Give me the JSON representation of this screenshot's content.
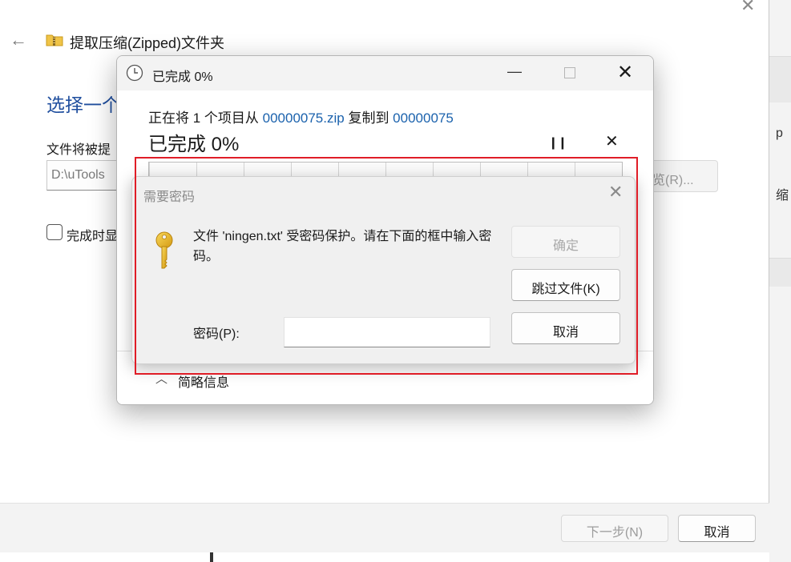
{
  "wizard": {
    "title": "提取压缩(Zipped)文件夹",
    "heading": "选择一个",
    "label": "文件将被提",
    "path_value": "D:\\uTools",
    "browse_label": "览(R)...",
    "checkbox_label": "完成时显",
    "next_button": "下一步(N)",
    "cancel_button": "取消",
    "right_strip_1": "p",
    "right_strip_2": "缩"
  },
  "progress": {
    "title": "已完成 0%",
    "line_prefix": "正在将 1 个项目从 ",
    "source": "00000075.zip",
    "line_middle": " 复制到 ",
    "destination": "00000075",
    "big_status": "已完成 0%",
    "percent": 0,
    "details_label": "简略信息"
  },
  "password_dialog": {
    "title": "需要密码",
    "message": "文件 'ningen.txt' 受密码保护。请在下面的框中输入密码。",
    "ok_button": "确定",
    "skip_button": "跳过文件(K)",
    "cancel_button": "取消",
    "password_label": "密码(P):",
    "password_value": ""
  },
  "colors": {
    "link": "#1b62ad",
    "heading": "#1f4e9e",
    "highlight": "#e01d27",
    "key": "#e8b820"
  },
  "icons": [
    "back-arrow-icon",
    "zip-folder-icon",
    "clock-icon",
    "minimize-icon",
    "maximize-icon",
    "close-icon",
    "pause-icon",
    "stop-icon",
    "chevron-up-icon",
    "key-icon"
  ]
}
